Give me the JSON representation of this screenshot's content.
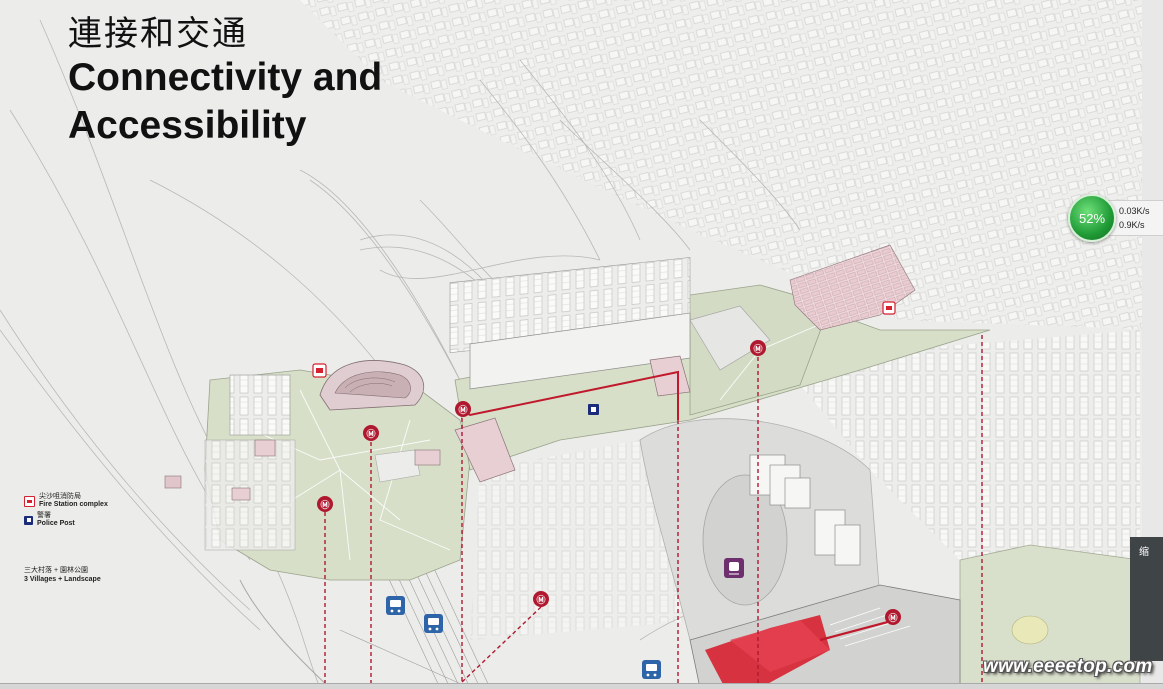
{
  "title": {
    "zh": "連接和交通",
    "en": "Connectivity and Accessibility"
  },
  "legend": {
    "fire_station": {
      "zh": "尖沙咀消防局",
      "en": "Fire Station complex",
      "color": "#d6202f"
    },
    "police_post": {
      "zh": "警署",
      "en": "Police Post",
      "color": "#1b2d7a"
    }
  },
  "villages_label": {
    "zh": "三大村落 + 園林公園",
    "en": "3 Villages + Landscape"
  },
  "speed_widget": {
    "percent": "52%",
    "up": "0.03K/s",
    "down": "0.9K/s"
  },
  "side_tab": "缩",
  "watermark": "www.eeeetop.com",
  "colors": {
    "mtr": "#b0182f",
    "route": "#c0192c",
    "landscape": "#d7dfc9",
    "pavilion": "#e8cfd3",
    "bus": "#2e64a8",
    "station": "#6d2f6e"
  },
  "icons": {
    "mtr": "mtr-station-icon",
    "bus": "bus-icon",
    "rail": "rail-station-icon",
    "fire": "fire-station-icon",
    "police": "police-post-icon"
  }
}
